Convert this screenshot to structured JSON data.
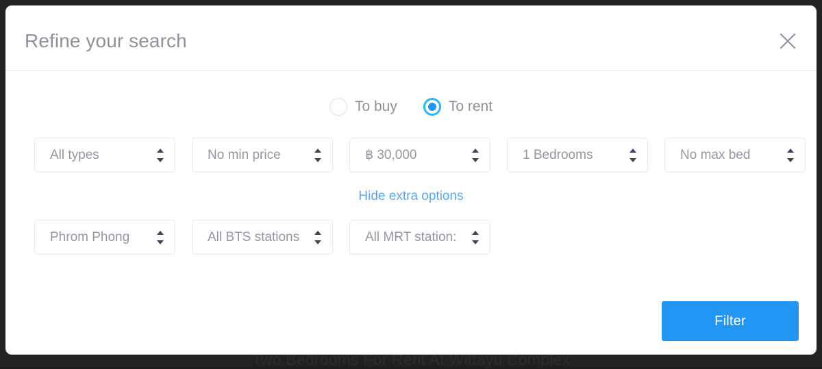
{
  "background": {
    "listing_title": "Two Bedrooms For Rent At Wittayu Complex"
  },
  "modal": {
    "title": "Refine your search",
    "close_icon": "close-icon",
    "listing_mode": {
      "options": [
        {
          "label": "To buy",
          "selected": false
        },
        {
          "label": "To rent",
          "selected": true
        }
      ]
    },
    "filters_primary": [
      {
        "name": "property-type",
        "value": "All types"
      },
      {
        "name": "min-price",
        "value": "No min price"
      },
      {
        "name": "max-price",
        "value": "฿ 30,000"
      },
      {
        "name": "min-bedrooms",
        "value": "1 Bedrooms"
      },
      {
        "name": "max-bedrooms",
        "value": "No max bed"
      }
    ],
    "toggle_extra_options": "Hide extra options",
    "filters_extra": [
      {
        "name": "area",
        "value": "Phrom Phong"
      },
      {
        "name": "bts-station",
        "value": "All BTS stations"
      },
      {
        "name": "mrt-station",
        "value": "All MRT station:"
      }
    ],
    "submit_label": "Filter"
  },
  "colors": {
    "accent": "#2196f3",
    "link": "#5aa9f0",
    "radio_ring": "#29b6f6",
    "text_muted": "#9297a1",
    "title": "#8e9199",
    "border": "#e6eaf0",
    "backdrop": "#212121"
  }
}
